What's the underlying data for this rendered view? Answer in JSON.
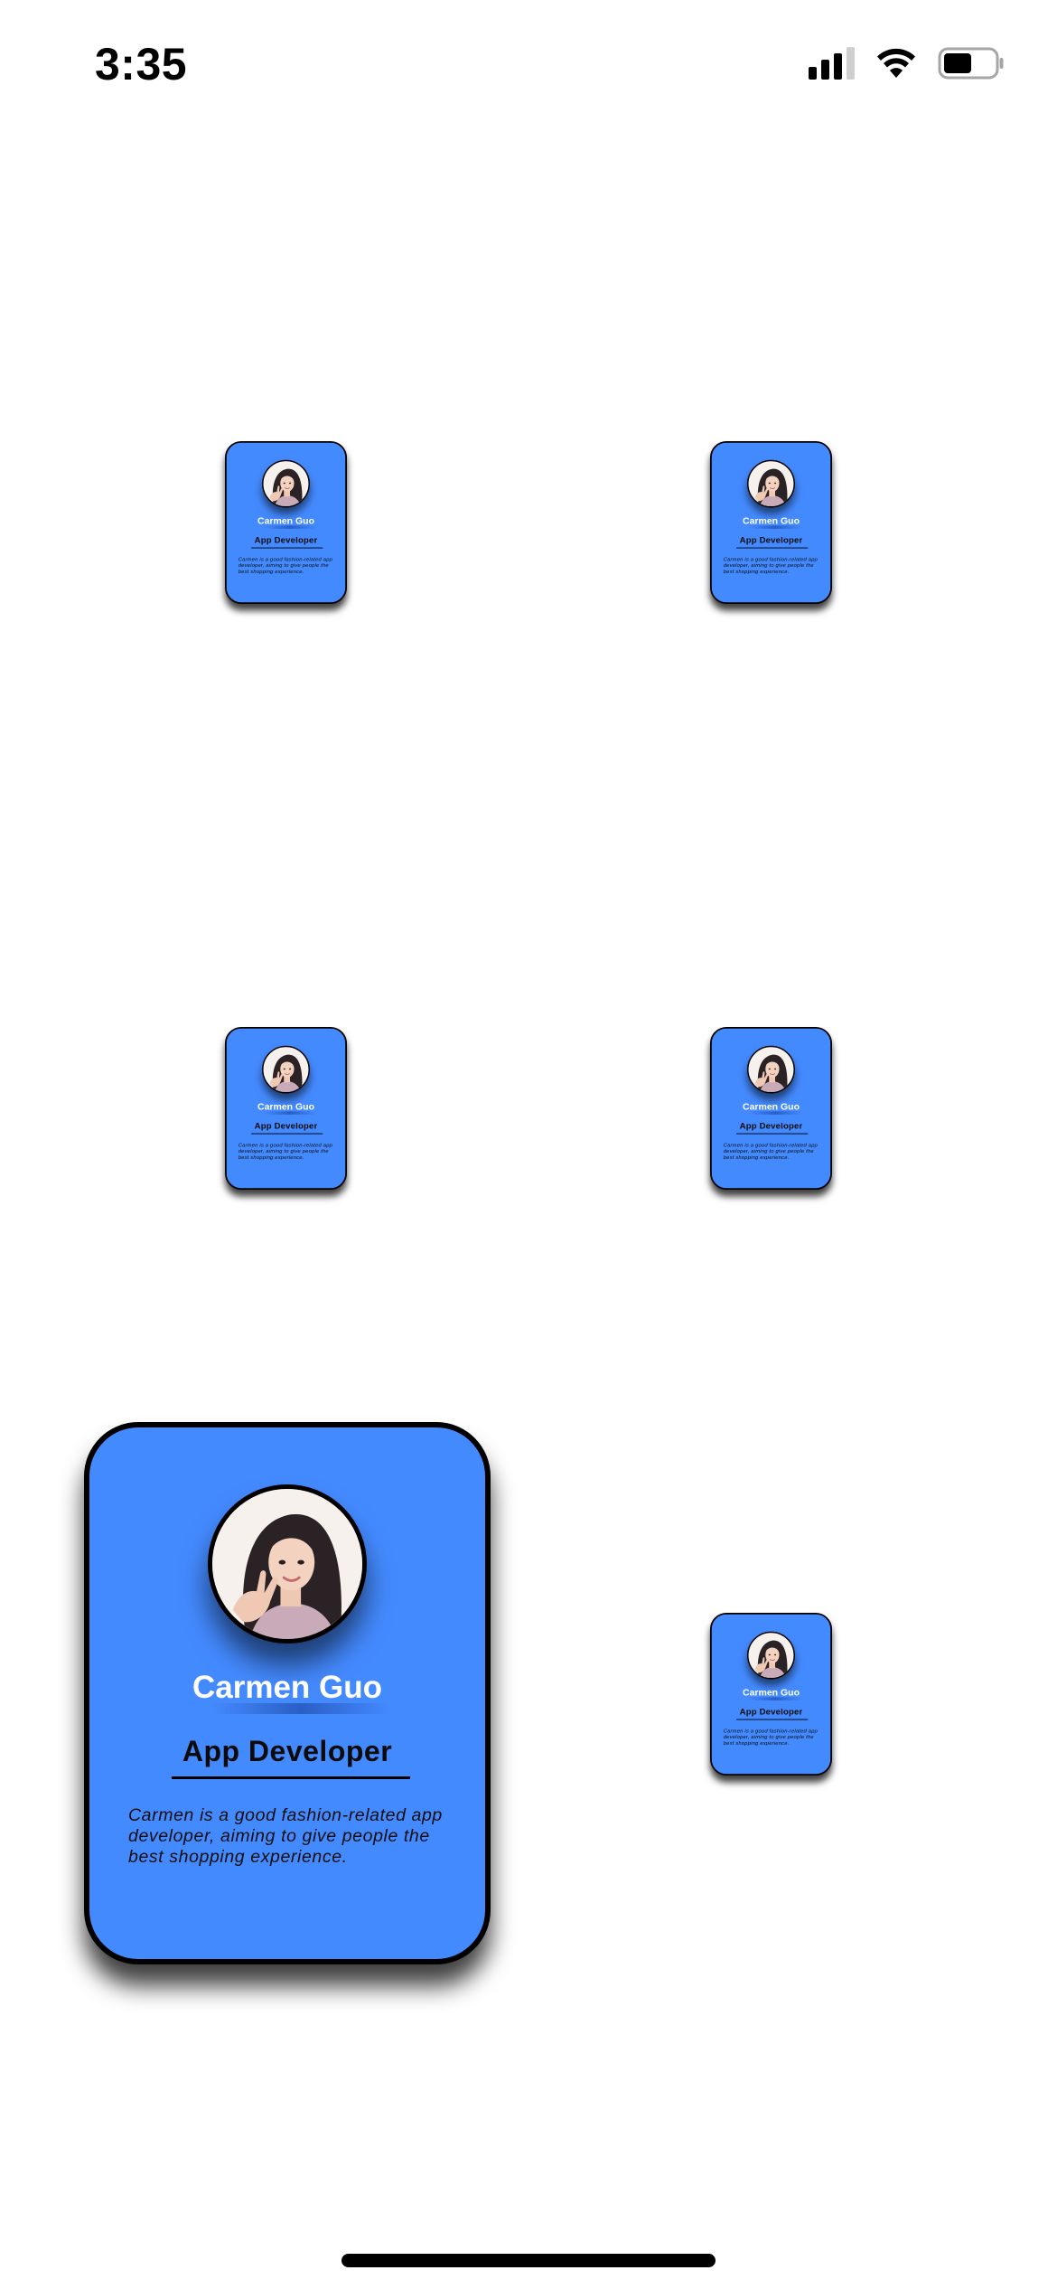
{
  "status_bar": {
    "time": "3:35",
    "icons": [
      "signal-icon",
      "wifi-icon",
      "battery-icon"
    ]
  },
  "profile": {
    "name": "Carmen Guo",
    "role": "App Developer",
    "bio": "Carmen is a good fashion-related app developer, aiming to give people the best shopping experience.",
    "avatar_icon": "profile-photo"
  },
  "cards": [
    {
      "id": "card-1",
      "size": "small"
    },
    {
      "id": "card-2",
      "size": "small"
    },
    {
      "id": "card-3",
      "size": "small"
    },
    {
      "id": "card-4",
      "size": "small"
    },
    {
      "id": "card-5",
      "size": "large"
    },
    {
      "id": "card-6",
      "size": "small"
    }
  ],
  "colors": {
    "card_background": "#448aff",
    "card_border": "#000000",
    "name_text": "#ffffff",
    "page_background": "#ffffff"
  }
}
